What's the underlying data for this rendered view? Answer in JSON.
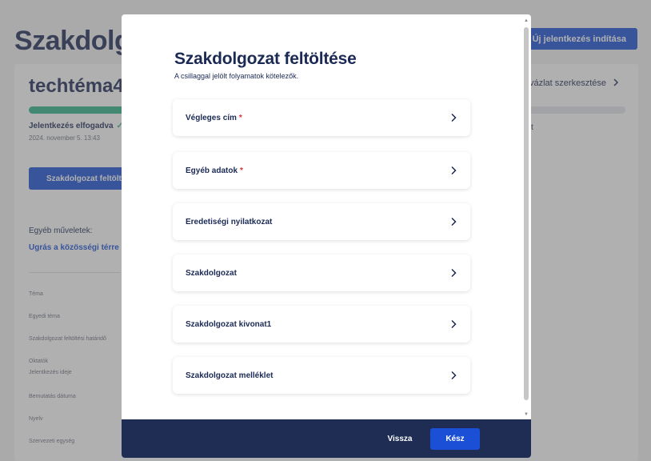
{
  "background": {
    "page_title": "Szakdolgo",
    "new_application_button": "Új jelentkezés indítása",
    "project_title": "techtéma4",
    "draft_link": "vázlat szerkesztése",
    "progress_value": 0.3,
    "status_text": "Jelentkezés elfogadva",
    "status_date": "2024. november 5. 13:43",
    "right_fragment": "t",
    "upload_button": "Szakdolgozat feltöltés",
    "other_operations_label": "Egyéb műveletek:",
    "community_link": "Ugrás a közösségi térre",
    "fields": [
      "Téma",
      "Egyedi téma",
      "Szakdolgozat feltöltési határidő",
      "Oktatók",
      "Jelentkezés ideje",
      "Bemutatás dátuma",
      "Nyelv",
      "Szervezeti egység"
    ]
  },
  "modal": {
    "title": "Szakdolgozat feltöltése",
    "subtitle": "A csillaggal jelölt folyamatok kötelezők.",
    "required_marker": "*",
    "sections": [
      {
        "label": "Végleges cím",
        "required": true
      },
      {
        "label": "Egyéb adatok",
        "required": true
      },
      {
        "label": "Eredetiségi nyilatkozat",
        "required": false
      },
      {
        "label": "Szakdolgozat",
        "required": false
      },
      {
        "label": "Szakdolgozat kivonat1",
        "required": false
      },
      {
        "label": "Szakdolgozat melléklet",
        "required": false
      }
    ],
    "footer": {
      "back_label": "Vissza",
      "done_label": "Kész"
    }
  },
  "icons": {
    "section_arrow": "chevron-right-icon",
    "status_check": "check-icon"
  },
  "colors": {
    "primary": "#1a4fd6",
    "navy": "#1b2a55",
    "footer": "#1f2d55",
    "success": "#2fb38a",
    "required": "#dd3333"
  }
}
